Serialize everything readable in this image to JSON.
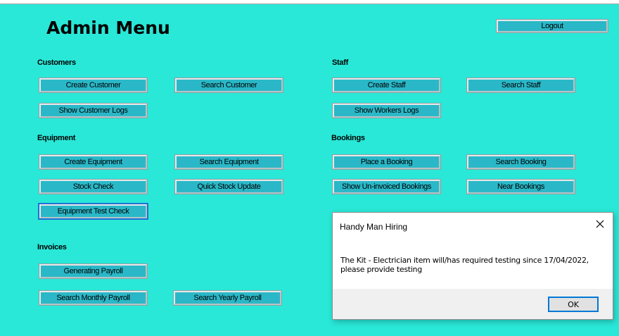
{
  "header": {
    "title": "Admin Menu",
    "logout_label": "Logout"
  },
  "customers": {
    "heading": "Customers",
    "create": "Create Customer",
    "search": "Search Customer",
    "logs": "Show Customer Logs"
  },
  "staff": {
    "heading": "Staff",
    "create": "Create Staff",
    "search": "Search Staff",
    "logs": "Show Workers Logs"
  },
  "equipment": {
    "heading": "Equipment",
    "create": "Create Equipment",
    "search": "Search Equipment",
    "stock_check": "Stock Check",
    "quick_stock": "Quick Stock Update",
    "test_check": "Equipment Test Check"
  },
  "bookings": {
    "heading": "Bookings",
    "place": "Place a Booking",
    "search": "Search Booking",
    "uninvoiced": "Show Un-invoiced Bookings",
    "near": "Near Bookings"
  },
  "invoices": {
    "heading": "Invoices",
    "generate_payroll": "Generating Payroll",
    "monthly_payroll": "Search Monthly Payroll",
    "yearly_payroll": "Search Yearly Payroll"
  },
  "dialog": {
    "title": "Handy Man Hiring",
    "message": "The Kit - Electrician item will/has required testing since 17/04/2022, please provide testing",
    "ok_label": "OK",
    "close_icon": "close-icon"
  },
  "colors": {
    "background": "#29e8d8",
    "button": "#2ab8c8",
    "focus": "#1d72d6"
  }
}
